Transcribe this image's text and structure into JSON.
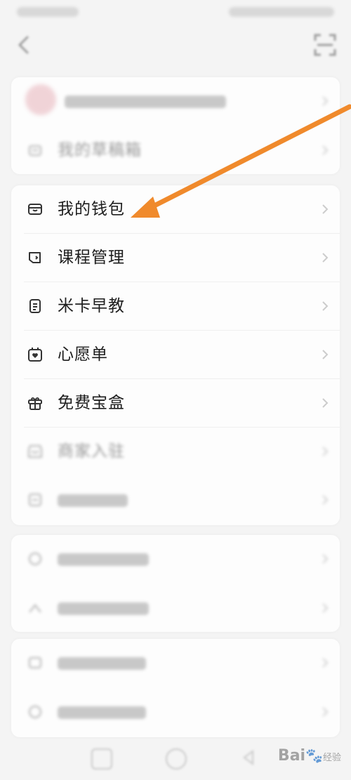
{
  "status_bar": {
    "left_text": "",
    "right_text": ""
  },
  "header": {
    "back_icon": "back-arrow-icon",
    "scan_icon": "scan-icon"
  },
  "top_card": {
    "profile_row": {
      "label": "",
      "icon": "avatar"
    },
    "drafts_row": {
      "label": "我的草稿箱",
      "icon": "drafts-icon"
    }
  },
  "menu": {
    "wallet": {
      "label": "我的钱包",
      "icon": "wallet-icon"
    },
    "courses": {
      "label": "课程管理",
      "icon": "book-icon"
    },
    "early_edu": {
      "label": "米卡早教",
      "icon": "notes-icon"
    },
    "wishlist": {
      "label": "心愿单",
      "icon": "heart-calendar-icon"
    },
    "gift_box": {
      "label": "免费宝盒",
      "icon": "gift-icon"
    },
    "merchant": {
      "label": "商家入驻",
      "icon": "shop-icon"
    },
    "ads": {
      "label": "",
      "icon": "ads-icon"
    }
  },
  "help_card": {
    "help_row": {
      "label": "",
      "icon": "help-icon"
    },
    "share_row": {
      "label": "",
      "icon": "share-icon"
    }
  },
  "settings_card": {
    "rate_row": {
      "label": "",
      "icon": "rate-icon"
    },
    "notify_row": {
      "label": "",
      "icon": "notification-icon"
    }
  },
  "annotation": {
    "arrow_color": "#f08a2c"
  },
  "watermark": {
    "brand": "Bai",
    "sub": "经验"
  },
  "colors": {
    "background": "#f4f4f4",
    "card": "#fdfdfd",
    "text": "#1e1e1e",
    "icon": "#333333"
  }
}
